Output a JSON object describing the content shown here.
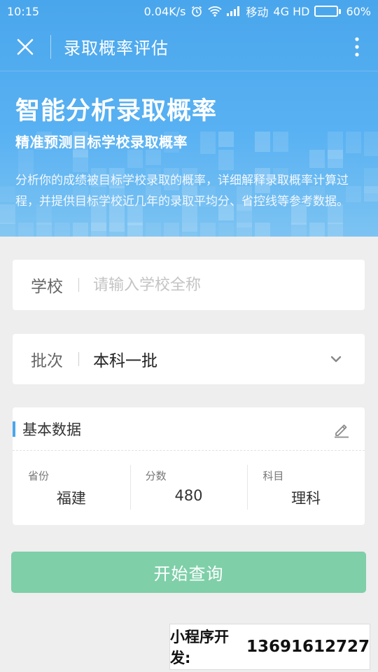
{
  "status_bar": {
    "time": "10:15",
    "net_speed": "0.04K/s",
    "carrier": "移动",
    "network": "4G HD",
    "battery": "60%"
  },
  "titlebar": {
    "title": "录取概率评估"
  },
  "hero": {
    "headline": "智能分析录取概率",
    "subline": "精准预测目标学校录取概率",
    "description": "分析你的成绩被目标学校录取的概率，详细解释录取概率计算过程，并提供目标学校近几年的录取平均分、省控线等参考数据。"
  },
  "school_field": {
    "label": "学校",
    "placeholder": "请输入学校全称",
    "value": ""
  },
  "batch_field": {
    "label": "批次",
    "value": "本科一批"
  },
  "basic_data": {
    "title": "基本数据",
    "columns": [
      {
        "label": "省份",
        "value": "福建"
      },
      {
        "label": "分数",
        "value": "480"
      },
      {
        "label": "科目",
        "value": "理科"
      }
    ]
  },
  "start_button": {
    "label": "开始查询"
  },
  "promo": {
    "label": "小程序开发:",
    "phone": "13691612727"
  },
  "colors": {
    "hero_blue": "#4aa6ec",
    "button_green": "#7fcfa9",
    "battery_red": "#ff6b5b"
  },
  "icons": [
    "close-icon",
    "more-vertical-icon",
    "chevron-down-icon",
    "pencil-edit-icon",
    "alarm-icon",
    "wifi-icon",
    "signal-icon",
    "battery-icon"
  ]
}
